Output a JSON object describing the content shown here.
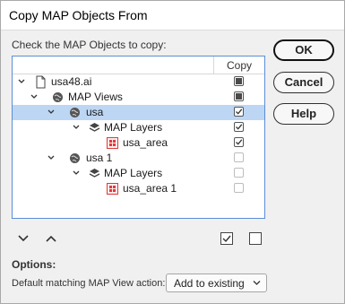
{
  "dialog": {
    "title": "Copy MAP Objects From",
    "instruction": "Check the MAP Objects to copy:"
  },
  "tree": {
    "column_header": "Copy",
    "rows": [
      {
        "label": "usa48.ai",
        "icon": "document-icon",
        "expanded": true,
        "check": "mixed",
        "selected": false
      },
      {
        "label": "MAP Views",
        "icon": "globe-icon",
        "expanded": true,
        "check": "mixed",
        "selected": false
      },
      {
        "label": "usa",
        "icon": "globe-icon",
        "expanded": true,
        "check": "checked",
        "selected": true
      },
      {
        "label": "MAP Layers",
        "icon": "layers-icon",
        "expanded": true,
        "check": "checked",
        "selected": false
      },
      {
        "label": "usa_area",
        "icon": "map-area-icon",
        "expanded": false,
        "check": "checked",
        "selected": false
      },
      {
        "label": "usa 1",
        "icon": "globe-icon",
        "expanded": true,
        "check": "unchecked",
        "selected": false
      },
      {
        "label": "MAP Layers",
        "icon": "layers-icon",
        "expanded": true,
        "check": "unchecked",
        "selected": false
      },
      {
        "label": "usa_area 1",
        "icon": "map-area-icon",
        "expanded": false,
        "check": "unchecked",
        "selected": false
      }
    ]
  },
  "buttons": {
    "ok": "OK",
    "cancel": "Cancel",
    "help": "Help"
  },
  "options": {
    "heading": "Options:",
    "action_label": "Default matching MAP View action:",
    "action_value": "Add to existing"
  },
  "colors": {
    "selection": "#bdd6f3",
    "panel_border": "#5a8ed6",
    "map_area_red": "#e03a3a"
  }
}
